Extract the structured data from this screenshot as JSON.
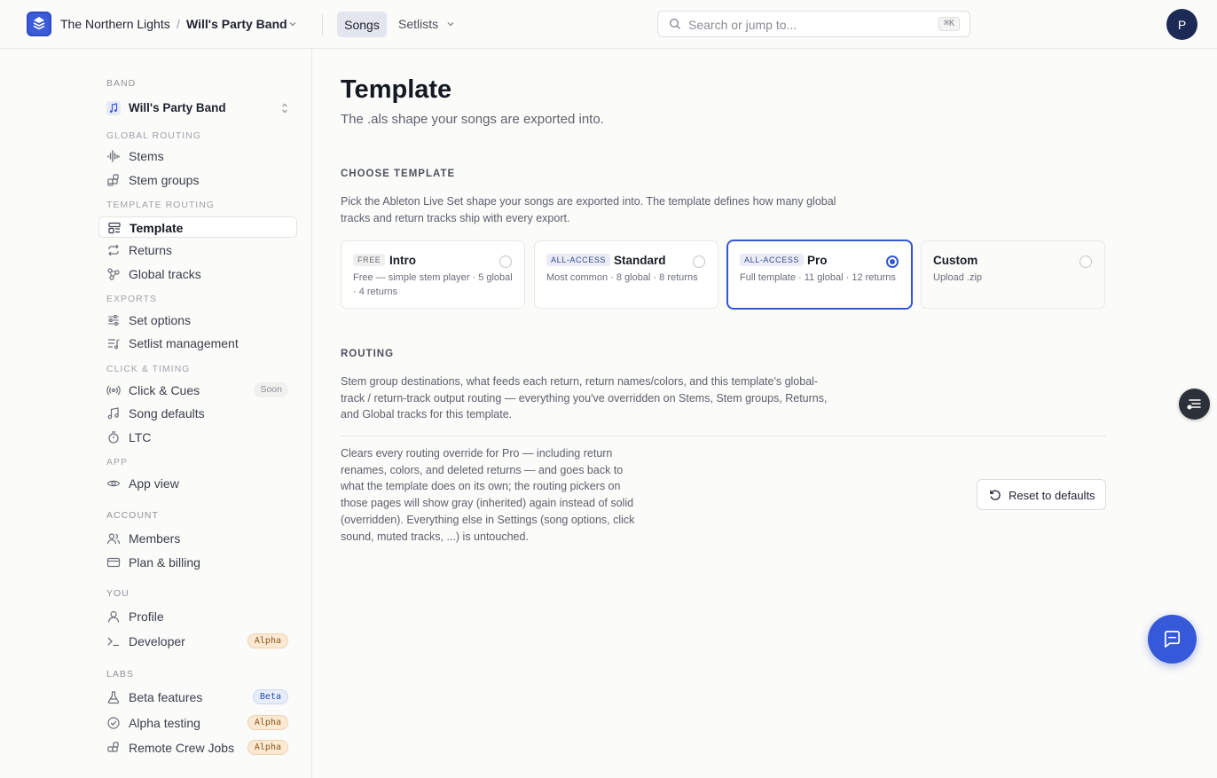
{
  "header": {
    "org_name": "The Northern Lights",
    "separator": "/",
    "band_name": "Will's Party Band",
    "nav_songs": "Songs",
    "nav_setlists": "Setlists",
    "search_placeholder": "Search or jump to...",
    "search_shortcut": "⌘K",
    "avatar_initial": "P",
    "brand_color": "#3b5bdb"
  },
  "sidebar": {
    "band_section": "BAND",
    "band_selected": "Will's Party Band",
    "global_routing_section": "GLOBAL ROUTING",
    "global_routing": [
      {
        "label": "Stems",
        "icon": "waveform-icon"
      },
      {
        "label": "Stem groups",
        "icon": "grid-plus-icon"
      }
    ],
    "template_routing_section": "TEMPLATE ROUTING",
    "template_routing": [
      {
        "label": "Template",
        "icon": "layout-template-icon",
        "active": true
      },
      {
        "label": "Returns",
        "icon": "repeat-icon"
      },
      {
        "label": "Global tracks",
        "icon": "nodes-icon"
      }
    ],
    "exports_section": "EXPORTS",
    "exports": [
      {
        "label": "Set options",
        "icon": "sliders-icon"
      },
      {
        "label": "Setlist management",
        "icon": "list-music-icon"
      }
    ],
    "click_section": "CLICK & TIMING",
    "click_timing": [
      {
        "label": "Click & Cues",
        "icon": "radio-signal-icon",
        "badge": "Soon"
      },
      {
        "label": "Song defaults",
        "icon": "music-note-icon"
      },
      {
        "label": "LTC",
        "icon": "timer-icon"
      }
    ],
    "app_section": "APP",
    "app": [
      {
        "label": "App view",
        "icon": "eye-icon"
      }
    ],
    "account_section": "ACCOUNT",
    "account": [
      {
        "label": "Members",
        "icon": "users-icon"
      },
      {
        "label": "Plan & billing",
        "icon": "credit-card-icon"
      }
    ],
    "you_section": "YOU",
    "you": [
      {
        "label": "Profile",
        "icon": "user-icon"
      },
      {
        "label": "Developer",
        "icon": "terminal-icon",
        "badge": "Alpha"
      }
    ],
    "labs_section": "LABS",
    "labs": [
      {
        "label": "Beta features",
        "icon": "flask-icon",
        "badge": "Beta"
      },
      {
        "label": "Alpha testing",
        "icon": "check-circle-icon",
        "badge": "Alpha"
      },
      {
        "label": "Remote Crew Jobs",
        "icon": "grid-plus-icon",
        "badge": "Alpha"
      }
    ]
  },
  "main": {
    "title": "Template",
    "subtitle": "The .als shape your songs are exported into.",
    "choose_heading": "CHOOSE TEMPLATE",
    "choose_desc_line1": "Pick the Ableton Live Set shape your songs are exported into. The template defines how many global",
    "choose_desc_line2": "tracks and return tracks ship with every export.",
    "templates": [
      {
        "tier": "FREE",
        "name": "Intro",
        "desc": "Free — simple stem player · 5 global · 4 returns",
        "selected": false
      },
      {
        "tier": "ALL-ACCESS",
        "name": "Standard",
        "desc": "Most common · 8 global · 8 returns",
        "selected": false
      },
      {
        "tier": "ALL-ACCESS",
        "name": "Pro",
        "desc": "Full template · 11 global · 12 returns",
        "selected": true
      },
      {
        "tier": "",
        "name": "Custom",
        "desc": "Upload .zip",
        "selected": false
      }
    ],
    "routing_heading": "ROUTING",
    "routing_desc_line1": "Stem group destinations, what feeds each return, return names/colors, and this template's global-",
    "routing_desc_line2": "track / return-track output routing — everything you've overridden on Stems, Stem groups, Returns,",
    "routing_desc_line3": "and Global tracks for this template.",
    "reset_desc_lines": [
      "Clears every routing override for Pro — including return",
      "renames, colors, and deleted returns — and goes back to",
      "what the template does on its own; the routing pickers on",
      "those pages will show gray (inherited) again instead of solid",
      "(overridden). Everything else in Settings (song options, click",
      "sound, muted tracks, ...) is untouched."
    ],
    "reset_button": "Reset to defaults",
    "accent_color": "#3457d5"
  }
}
